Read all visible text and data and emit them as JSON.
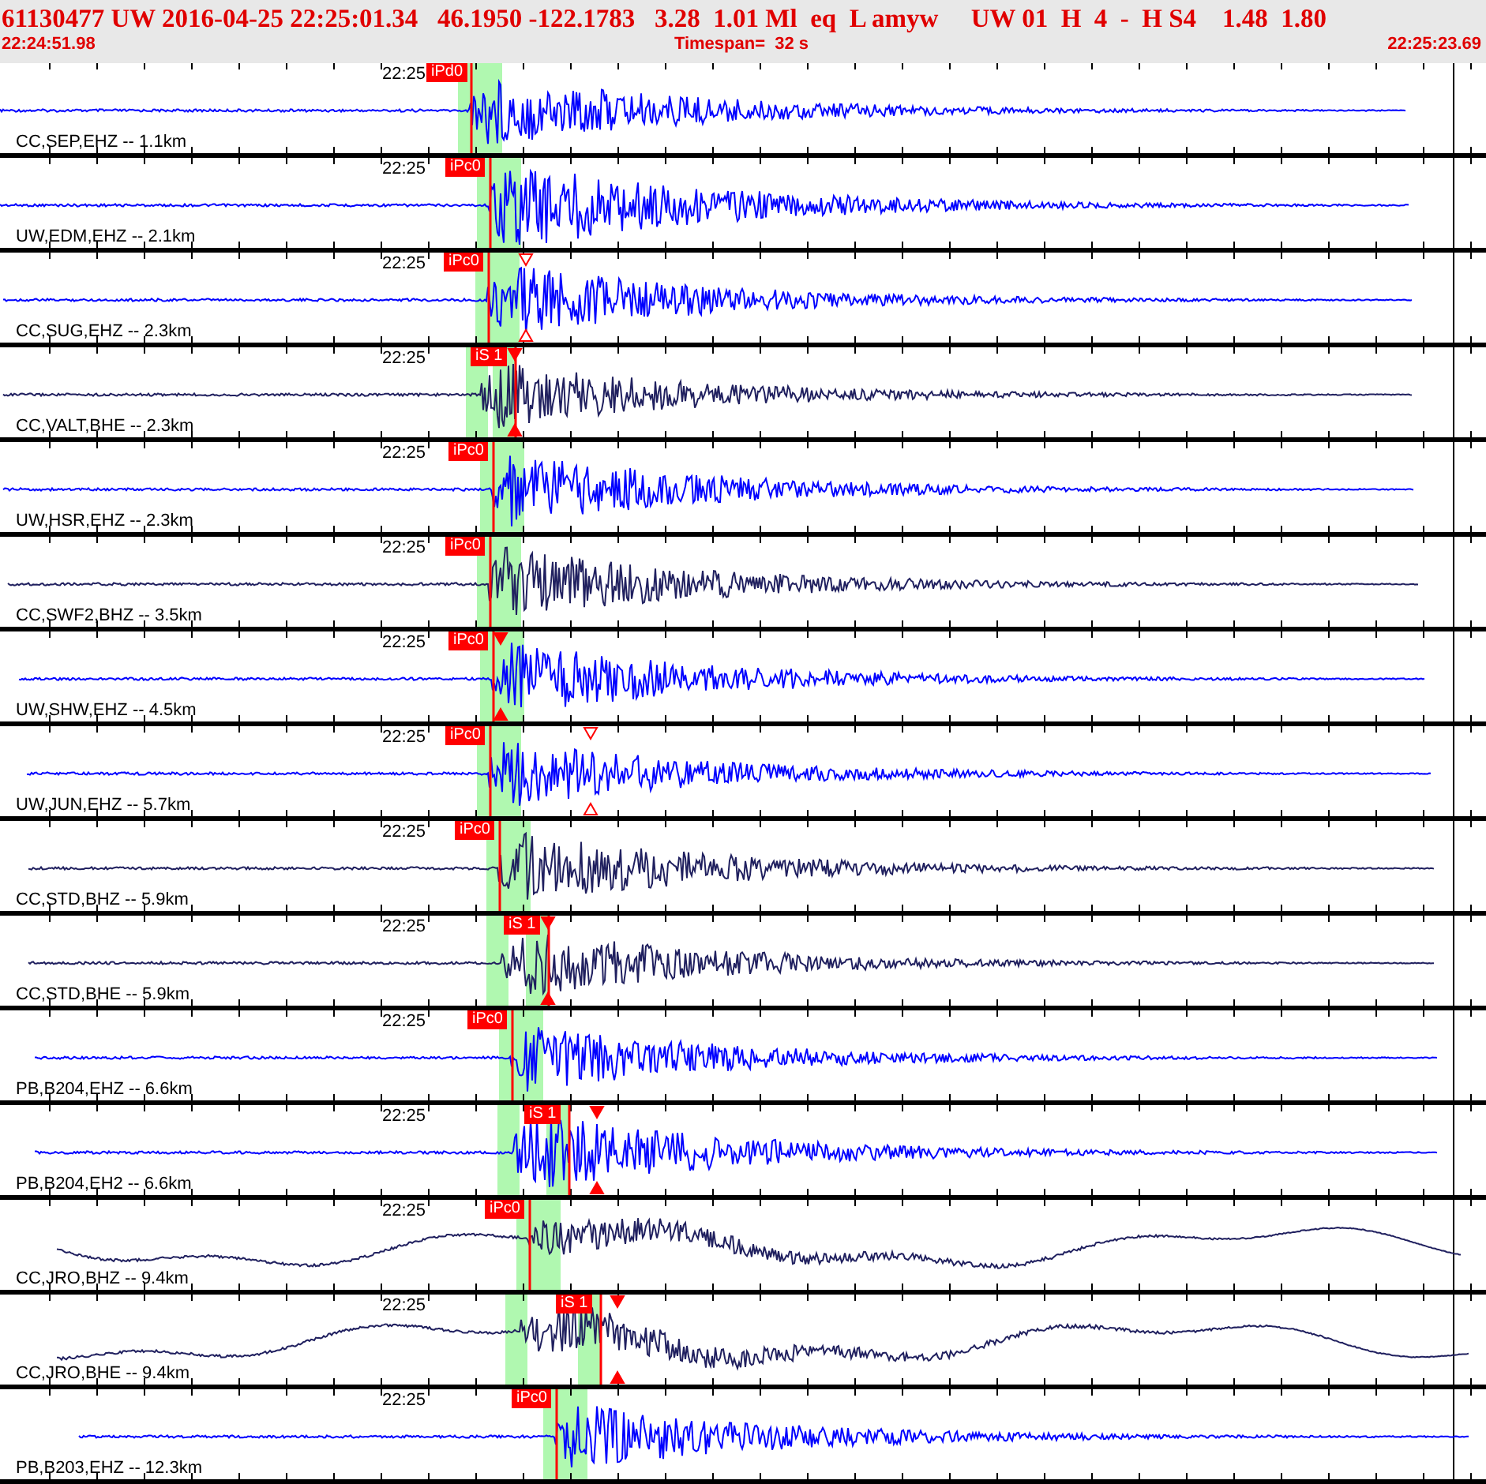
{
  "header": {
    "event_line": "61130477 UW 2016-04-25 22:25:01.34   46.1950 -122.1783   3.28  1.01 Ml  eq  L amyw     UW 01  H  4  -  H S4    1.48  1.80",
    "start_time": "22:24:51.98",
    "timespan": "Timespan=  32 s",
    "end_time": "22:25:23.69"
  },
  "traces": [
    {
      "station": "CC,SEP,EHZ -- 1.1km",
      "time_label": "22:25",
      "color": "#0000ff",
      "pick": "iPd0"
    },
    {
      "station": "UW,EDM,EHZ -- 2.1km",
      "time_label": "22:25",
      "color": "#0000ff",
      "pick": "iPc0"
    },
    {
      "station": "CC,SUG,EHZ -- 2.3km",
      "time_label": "22:25",
      "color": "#0000ff",
      "pick": "iPc0"
    },
    {
      "station": "CC,VALT,BHE -- 2.3km",
      "time_label": "22:25",
      "color": "#20205f",
      "pick": "iS 1"
    },
    {
      "station": "UW,HSR,EHZ -- 2.3km",
      "time_label": "22:25",
      "color": "#0000ff",
      "pick": "iPc0"
    },
    {
      "station": "CC,SWF2,BHZ -- 3.5km",
      "time_label": "22:25",
      "color": "#20205f",
      "pick": "iPc0"
    },
    {
      "station": "UW,SHW,EHZ -- 4.5km",
      "time_label": "22:25",
      "color": "#0000ff",
      "pick": "iPc0"
    },
    {
      "station": "UW,JUN,EHZ -- 5.7km",
      "time_label": "22:25",
      "color": "#0000ff",
      "pick": "iPc0"
    },
    {
      "station": "CC,STD,BHZ -- 5.9km",
      "time_label": "22:25",
      "color": "#20205f",
      "pick": "iPc0"
    },
    {
      "station": "CC,STD,BHE -- 5.9km",
      "time_label": "22:25",
      "color": "#20205f",
      "pick": "iS 1"
    },
    {
      "station": "PB,B204,EHZ -- 6.6km",
      "time_label": "22:25",
      "color": "#0000ff",
      "pick": "iPc0"
    },
    {
      "station": "PB,B204,EH2 -- 6.6km",
      "time_label": "22:25",
      "color": "#0000ff",
      "pick": "iS 1"
    },
    {
      "station": "CC,JRO,BHZ -- 9.4km",
      "time_label": "22:25",
      "color": "#20205f",
      "pick": "iPc0"
    },
    {
      "station": "CC,JRO,BHE -- 9.4km",
      "time_label": "22:25",
      "color": "#20205f",
      "pick": "iS 1"
    },
    {
      "station": "PB,B203,EHZ -- 12.3km",
      "time_label": "22:25",
      "color": "#0000ff",
      "pick": "iPc0"
    }
  ]
}
